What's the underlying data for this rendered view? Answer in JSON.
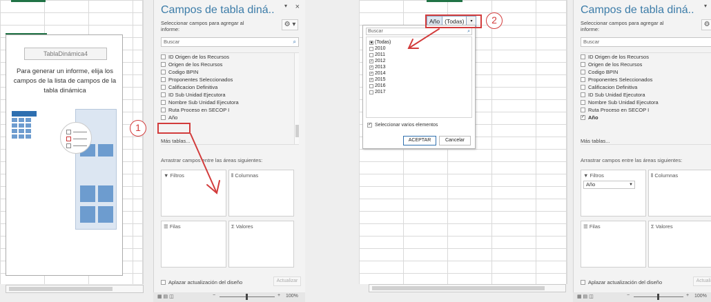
{
  "step1": {
    "annotation_number": "1",
    "pivot_placeholder": {
      "name": "TablaDinámica4",
      "message": "Para generar un informe, elija los campos de la lista de campos de la tabla dinámica"
    }
  },
  "step2": {
    "annotation_number": "2",
    "filter_field": {
      "name": "Año",
      "value": "(Todas)",
      "button": "▾"
    },
    "filter_popup": {
      "search_placeholder": "Buscar",
      "options": [
        {
          "label": "(Todas)",
          "state": "mixed"
        },
        {
          "label": "2010",
          "state": "off"
        },
        {
          "label": "2011",
          "state": "off"
        },
        {
          "label": "2012",
          "state": "on"
        },
        {
          "label": "2013",
          "state": "on"
        },
        {
          "label": "2014",
          "state": "on"
        },
        {
          "label": "2015",
          "state": "on"
        },
        {
          "label": "2016",
          "state": "off"
        },
        {
          "label": "2017",
          "state": "off"
        }
      ],
      "multi_select_label": "Seleccionar varios elementos",
      "ok_label": "ACEPTAR",
      "cancel_label": "Cancelar"
    }
  },
  "panel": {
    "title": "Campos de tabla diná..",
    "dropdown_glyph": "▾",
    "close_glyph": "×",
    "subtitle": "Seleccionar campos para agregar al informe:",
    "gear_glyph": "⚙ ▾",
    "search_placeholder": "Buscar",
    "fields": [
      "ID Origen de los Recursos",
      "Origen de los Recursos",
      "Codigo BPIN",
      "Proponentes Seleccionados",
      "Calificacion Definitiva",
      "ID Sub Unidad Ejecutora",
      "Nombre Sub Unidad Ejecutora",
      "Ruta Proceso en SECOP I",
      "Año"
    ],
    "more_tables": "Más tablas...",
    "drag_hint": "Arrastrar campos entre las áreas siguientes:",
    "areas": {
      "filters": "Filtros",
      "columns": "Columnas",
      "rows": "Filas",
      "values": "Valores"
    },
    "filter_chip": "Año",
    "defer_label": "Aplazar actualización del diseño",
    "update_label": "Actualizar"
  },
  "status_bar": {
    "zoom": "100%"
  },
  "colors": {
    "annotation": "#d23b3b",
    "title": "#3c7ca8",
    "accent": "#2f6fad"
  }
}
